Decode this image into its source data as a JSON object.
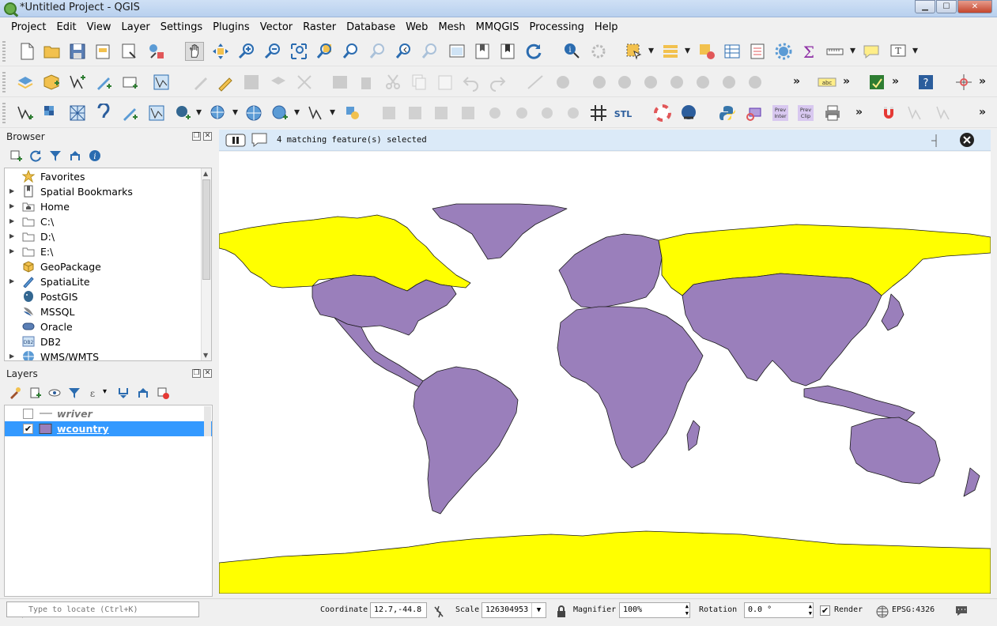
{
  "window": {
    "title": "*Untitled Project - QGIS"
  },
  "menu": [
    "Project",
    "Edit",
    "View",
    "Layer",
    "Settings",
    "Plugins",
    "Vector",
    "Raster",
    "Database",
    "Web",
    "Mesh",
    "MMQGIS",
    "Processing",
    "Help"
  ],
  "browser": {
    "title": "Browser",
    "items": [
      {
        "label": "Favorites",
        "icon": "star-icon",
        "expandable": false
      },
      {
        "label": "Spatial Bookmarks",
        "icon": "bookmark-icon",
        "expandable": true
      },
      {
        "label": "Home",
        "icon": "home-folder-icon",
        "expandable": true
      },
      {
        "label": "C:\\",
        "icon": "drive-icon",
        "expandable": true
      },
      {
        "label": "D:\\",
        "icon": "drive-icon",
        "expandable": true
      },
      {
        "label": "E:\\",
        "icon": "drive-icon",
        "expandable": true
      },
      {
        "label": "GeoPackage",
        "icon": "geopackage-icon",
        "expandable": false
      },
      {
        "label": "SpatiaLite",
        "icon": "spatialite-icon",
        "expandable": true
      },
      {
        "label": "PostGIS",
        "icon": "postgis-icon",
        "expandable": false
      },
      {
        "label": "MSSQL",
        "icon": "mssql-icon",
        "expandable": false
      },
      {
        "label": "Oracle",
        "icon": "oracle-icon",
        "expandable": false
      },
      {
        "label": "DB2",
        "icon": "db2-icon",
        "expandable": false
      },
      {
        "label": "WMS/WMTS",
        "icon": "wms-icon",
        "expandable": true
      }
    ]
  },
  "layers": {
    "title": "Layers",
    "items": [
      {
        "name": "wriver",
        "checked": false,
        "selected": false,
        "symbol": "line"
      },
      {
        "name": "wcountry",
        "checked": true,
        "selected": true,
        "symbol": "fill"
      }
    ]
  },
  "message_bar": {
    "text": "4 matching feature(s) selected"
  },
  "map": {
    "background": "#ffffff",
    "country_fill": "#9a7fbb",
    "selected_fill": "#ffff00",
    "outline": "#1a1a1a"
  },
  "status": {
    "locate_placeholder": "Type to locate (Ctrl+K)",
    "coordinate_label": "Coordinate",
    "coordinate": "12.7,-44.8",
    "scale_label": "Scale",
    "scale": "126304953",
    "magnifier_label": "Magnifier",
    "magnifier": "100%",
    "rotation_label": "Rotation",
    "rotation": "0.0 °",
    "render_label": "Render",
    "render_checked": true,
    "crs": "EPSG:4326"
  }
}
